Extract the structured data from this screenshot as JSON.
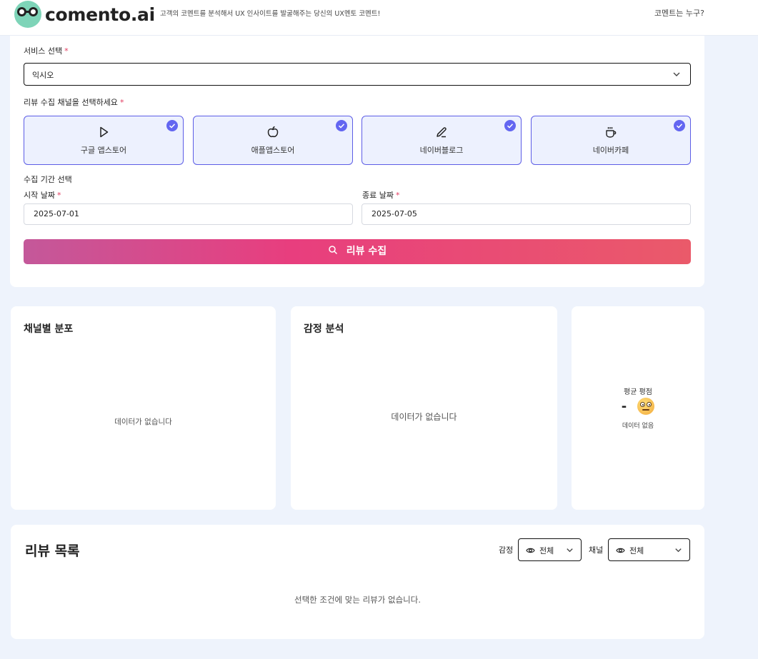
{
  "header": {
    "brand": "comento.ai",
    "tagline": "고객의 코멘트를 분석해서 UX 인사이트를 발굴해주는 당신의 UX멘토 코멘트!",
    "nav_link": "코멘트는 누구?"
  },
  "form": {
    "service_label": "서비스 선택",
    "service_value": "익시오",
    "channel_label": "리뷰 수집 채널을 선택하세요",
    "channels": [
      {
        "label": "구글 앱스토어",
        "icon": "play-icon",
        "selected": true
      },
      {
        "label": "애플앱스토어",
        "icon": "apple-icon",
        "selected": true
      },
      {
        "label": "네이버블로그",
        "icon": "pen-icon",
        "selected": true
      },
      {
        "label": "네이버카페",
        "icon": "coffee-icon",
        "selected": true
      }
    ],
    "period_label": "수집 기간 선택",
    "start_label": "시작 날짜",
    "start_value": "2025-07-01",
    "end_label": "종료 날짜",
    "end_value": "2025-07-05",
    "required_mark": "*",
    "collect_button": "리뷰 수집"
  },
  "distribution": {
    "title": "채널별 분포",
    "empty": "데이터가 없습니다"
  },
  "sentiment": {
    "title": "감정 분석",
    "empty": "데이터가 없습니다"
  },
  "rating": {
    "label": "평균 평점",
    "value": "-",
    "sub": "데이터 없음"
  },
  "reviews": {
    "title": "리뷰 목록",
    "sentiment_filter_label": "감정",
    "sentiment_filter_value": "전체",
    "channel_filter_label": "채널",
    "channel_filter_value": "전체",
    "empty": "선택한 조건에 맞는 리뷰가 없습니다."
  },
  "colors": {
    "accent": "#6366f1",
    "required": "#e23b5f",
    "button_gradient_start": "#c4589a",
    "button_gradient_end": "#ea5a6a"
  }
}
